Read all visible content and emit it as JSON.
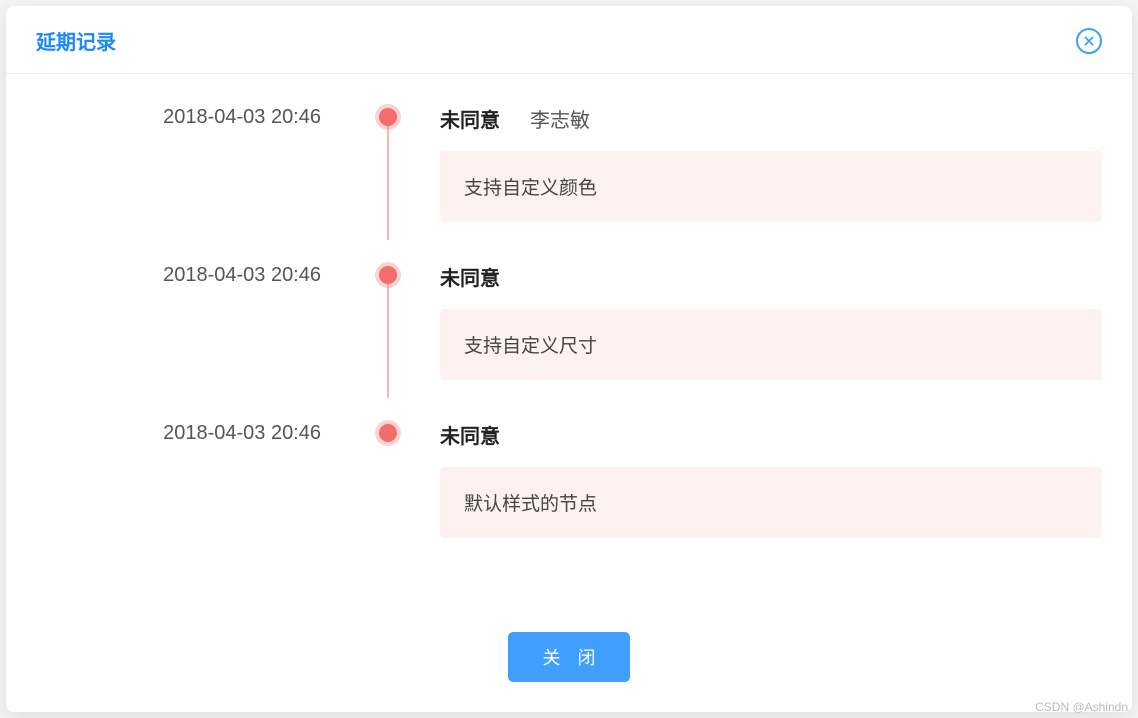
{
  "modal": {
    "title": "延期记录",
    "close_button_label": "关 闭"
  },
  "timeline": {
    "items": [
      {
        "time": "2018-04-03 20:46",
        "status": "未同意",
        "user": "李志敏",
        "description": "支持自定义颜色"
      },
      {
        "time": "2018-04-03 20:46",
        "status": "未同意",
        "user": "",
        "description": "支持自定义尺寸"
      },
      {
        "time": "2018-04-03 20:46",
        "status": "未同意",
        "user": "",
        "description": "默认样式的节点"
      }
    ]
  },
  "watermark": "CSDN @Ashindn"
}
